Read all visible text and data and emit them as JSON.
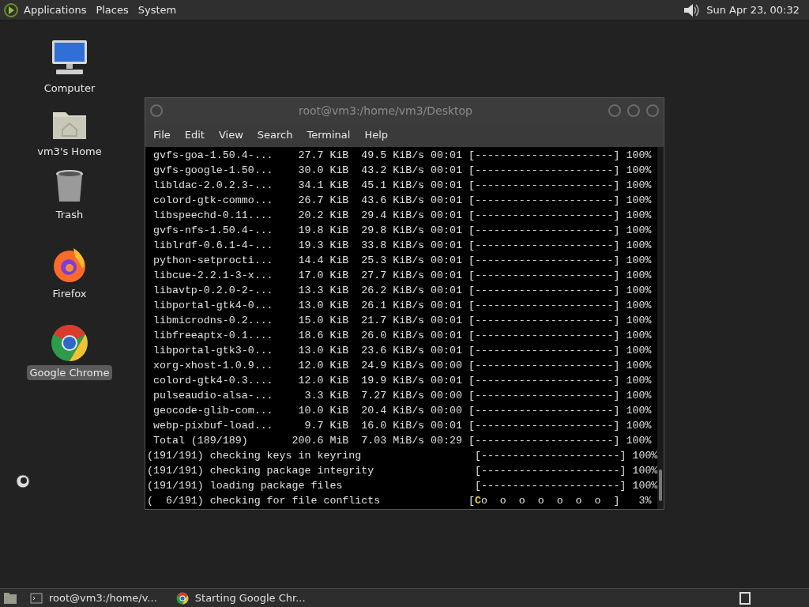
{
  "top_panel": {
    "menus": [
      "Applications",
      "Places",
      "System"
    ],
    "clock": "Sun Apr 23, 00:32"
  },
  "desktop_icons": [
    {
      "kind": "computer",
      "label": "Computer",
      "selected": false
    },
    {
      "kind": "home",
      "label": "vm3's Home",
      "selected": false
    },
    {
      "kind": "trash",
      "label": "Trash",
      "selected": false
    },
    {
      "kind": "firefox",
      "label": "Firefox",
      "selected": false
    },
    {
      "kind": "chrome",
      "label": "Google Chrome",
      "selected": true
    }
  ],
  "terminal": {
    "title": "root@vm3:/home/vm3/Desktop",
    "menus": [
      "File",
      "Edit",
      "View",
      "Search",
      "Terminal",
      "Help"
    ],
    "lines": [
      {
        "kind": "text",
        "text": " gvfs-goa-1.50.4-...    27.7 KiB  49.5 KiB/s 00:01 [----------------------] 100%"
      },
      {
        "kind": "text",
        "text": " gvfs-google-1.50...    30.0 KiB  43.2 KiB/s 00:01 [----------------------] 100%"
      },
      {
        "kind": "text",
        "text": " libldac-2.0.2.3-...    34.1 KiB  45.1 KiB/s 00:01 [----------------------] 100%"
      },
      {
        "kind": "text",
        "text": " colord-gtk-commo...    26.7 KiB  43.6 KiB/s 00:01 [----------------------] 100%"
      },
      {
        "kind": "text",
        "text": " libspeechd-0.11....    20.2 KiB  29.4 KiB/s 00:01 [----------------------] 100%"
      },
      {
        "kind": "text",
        "text": " gvfs-nfs-1.50.4-...    19.8 KiB  29.8 KiB/s 00:01 [----------------------] 100%"
      },
      {
        "kind": "text",
        "text": " liblrdf-0.6.1-4-...    19.3 KiB  33.8 KiB/s 00:01 [----------------------] 100%"
      },
      {
        "kind": "text",
        "text": " python-setprocti...    14.4 KiB  25.3 KiB/s 00:01 [----------------------] 100%"
      },
      {
        "kind": "text",
        "text": " libcue-2.2.1-3-x...    17.0 KiB  27.7 KiB/s 00:01 [----------------------] 100%"
      },
      {
        "kind": "text",
        "text": " libavtp-0.2.0-2-...    13.3 KiB  26.2 KiB/s 00:01 [----------------------] 100%"
      },
      {
        "kind": "text",
        "text": " libportal-gtk4-0...    13.0 KiB  26.1 KiB/s 00:01 [----------------------] 100%"
      },
      {
        "kind": "text",
        "text": " libmicrodns-0.2....    15.0 KiB  21.7 KiB/s 00:01 [----------------------] 100%"
      },
      {
        "kind": "text",
        "text": " libfreeaptx-0.1....    18.6 KiB  26.0 KiB/s 00:01 [----------------------] 100%"
      },
      {
        "kind": "text",
        "text": " libportal-gtk3-0...    13.0 KiB  23.6 KiB/s 00:01 [----------------------] 100%"
      },
      {
        "kind": "text",
        "text": " xorg-xhost-1.0.9...    12.0 KiB  24.9 KiB/s 00:00 [----------------------] 100%"
      },
      {
        "kind": "text",
        "text": " colord-gtk4-0.3....    12.0 KiB  19.9 KiB/s 00:01 [----------------------] 100%"
      },
      {
        "kind": "text",
        "text": " pulseaudio-alsa-...     3.3 KiB  7.27 KiB/s 00:00 [----------------------] 100%"
      },
      {
        "kind": "text",
        "text": " geocode-glib-com...    10.0 KiB  20.4 KiB/s 00:00 [----------------------] 100%"
      },
      {
        "kind": "text",
        "text": " webp-pixbuf-load...     9.7 KiB  16.0 KiB/s 00:01 [----------------------] 100%"
      },
      {
        "kind": "text",
        "text": " Total (189/189)       200.6 MiB  7.03 MiB/s 00:29 [----------------------] 100%"
      },
      {
        "kind": "text",
        "text": "(191/191) checking keys in keyring                  [----------------------] 100%"
      },
      {
        "kind": "text",
        "text": "(191/191) checking package integrity                [----------------------] 100%"
      },
      {
        "kind": "text",
        "text": "(191/191) loading package files                     [----------------------] 100%"
      },
      {
        "kind": "pacman",
        "before": "(  6/191) checking for file conflicts              [",
        "eater": "C",
        "after": "o  o  o  o  o  o  o  ]   3%"
      }
    ]
  },
  "taskbar": {
    "tasks": [
      {
        "kind": "terminal",
        "label": "root@vm3:/home/v..."
      },
      {
        "kind": "chrome",
        "label": "Starting Google Chr..."
      }
    ]
  }
}
